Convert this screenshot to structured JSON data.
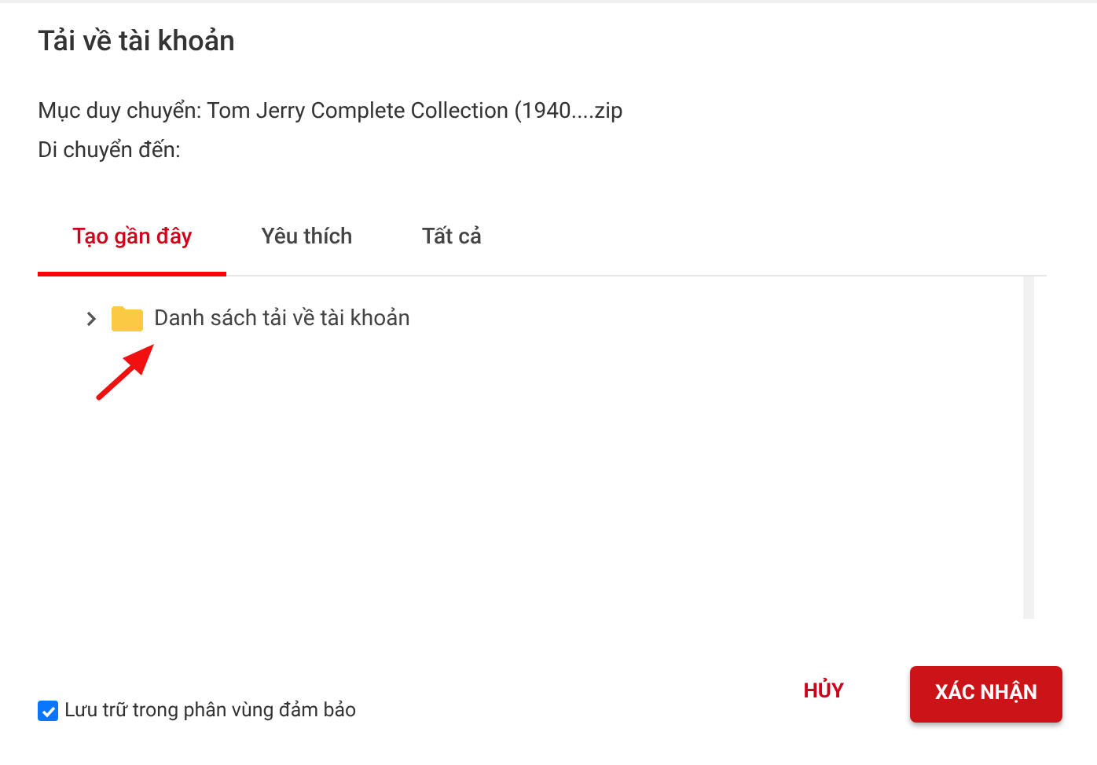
{
  "dialog": {
    "title": "Tải về tài khoản",
    "source_line": "Mục duy chuyển: Tom Jerry Complete Collection (1940....zip",
    "destination_label": "Di chuyển đến:"
  },
  "tabs": [
    {
      "label": "Tạo gần đây",
      "selected": true
    },
    {
      "label": "Yêu thích",
      "selected": false
    },
    {
      "label": "Tất cả",
      "selected": false
    }
  ],
  "tree": [
    {
      "label": "Danh sách tải về tài khoản",
      "expanded": false
    }
  ],
  "footer": {
    "checkbox": {
      "label": "Lưu trữ trong phân vùng đảm bảo",
      "checked": true
    },
    "buttons": [
      {
        "label": "HỦY",
        "kind": "text"
      },
      {
        "label": "XÁC NHẬN",
        "kind": "primary"
      }
    ]
  }
}
